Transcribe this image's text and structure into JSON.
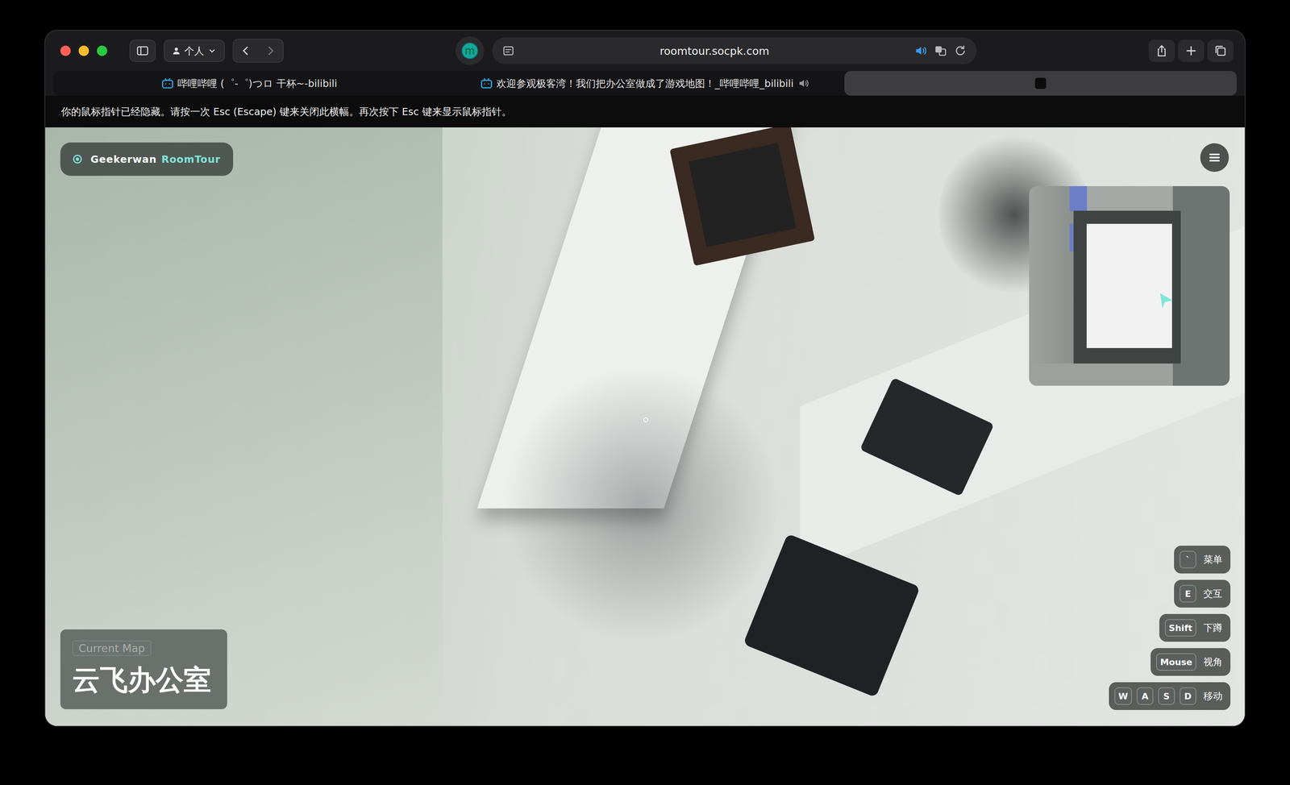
{
  "window": {
    "profile": "个人",
    "extension": "m",
    "url": "roomtour.socpk.com"
  },
  "tabs": [
    {
      "label": "哔哩哔哩 (゜-゜)つロ 干杯~-bilibili",
      "selected": false,
      "audio": false
    },
    {
      "label": "欢迎参观极客湾！我们把办公室做成了游戏地图！_哔哩哔哩_bilibili",
      "selected": false,
      "audio": true
    },
    {
      "selected": true,
      "audio": false
    }
  ],
  "banner": {
    "text": "你的鼠标指针已经隐藏。请按一次 Esc (Escape) 键来关闭此横幅。再次按下 Esc 键来显示鼠标指针。"
  },
  "game": {
    "brand": "Geekerwan",
    "product": "RoomTour",
    "map_label": "Current Map",
    "map_name": "云飞办公室",
    "controls": [
      {
        "keys": [
          "`"
        ],
        "action": "菜单"
      },
      {
        "keys": [
          "E"
        ],
        "action": "交互"
      },
      {
        "keys": [
          "Shift"
        ],
        "action": "下蹲"
      },
      {
        "keys": [
          "Mouse"
        ],
        "action": "视角"
      },
      {
        "keys": [
          "W",
          "A",
          "S",
          "D"
        ],
        "action": "移动"
      }
    ]
  }
}
